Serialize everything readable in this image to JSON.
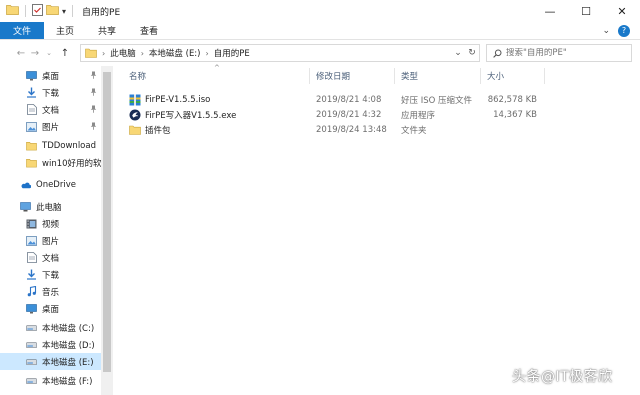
{
  "window": {
    "title": "自用的PE",
    "controls": {
      "minimize": "—",
      "maximize": "☐",
      "close": "✕"
    }
  },
  "ribbon": {
    "tabs": [
      "文件",
      "主页",
      "共享",
      "查看"
    ],
    "collapse_glyph": "⌄",
    "help_glyph": "?"
  },
  "address": {
    "crumbs": [
      "此电脑",
      "本地磁盘 (E:)",
      "自用的PE"
    ],
    "dropdown_glyph": "⌄",
    "refresh_glyph": "↻"
  },
  "search": {
    "placeholder": "搜索\"自用的PE\""
  },
  "nav_pane": {
    "items": [
      {
        "label": "桌面",
        "icon": "desktop-icon",
        "pinned": true
      },
      {
        "label": "下载",
        "icon": "download-icon",
        "pinned": true
      },
      {
        "label": "文档",
        "icon": "documents-icon",
        "pinned": true
      },
      {
        "label": "图片",
        "icon": "pictures-icon",
        "pinned": true
      },
      {
        "label": "TDDownload",
        "icon": "folder-icon",
        "pinned": false
      },
      {
        "label": "win10好用的软件",
        "icon": "folder-icon",
        "pinned": false
      },
      {
        "label": "OneDrive",
        "icon": "onedrive-icon",
        "pinned": false
      },
      {
        "label": "此电脑",
        "icon": "this-pc-icon",
        "pinned": false
      },
      {
        "label": "视频",
        "icon": "videos-icon",
        "pinned": false
      },
      {
        "label": "图片",
        "icon": "pictures-icon",
        "pinned": false
      },
      {
        "label": "文档",
        "icon": "documents-icon",
        "pinned": false
      },
      {
        "label": "下载",
        "icon": "download-icon",
        "pinned": false
      },
      {
        "label": "音乐",
        "icon": "music-icon",
        "pinned": false
      },
      {
        "label": "桌面",
        "icon": "desktop-icon",
        "pinned": false
      },
      {
        "label": "本地磁盘 (C:)",
        "icon": "drive-icon",
        "pinned": false
      },
      {
        "label": "本地磁盘 (D:)",
        "icon": "drive-icon",
        "pinned": false
      },
      {
        "label": "本地磁盘 (E:)",
        "icon": "drive-icon",
        "pinned": false,
        "selected": true
      },
      {
        "label": "本地磁盘 (F:)",
        "icon": "drive-icon",
        "pinned": false
      }
    ]
  },
  "file_list": {
    "columns": [
      "名称",
      "修改日期",
      "类型",
      "大小"
    ],
    "rows": [
      {
        "name": "FirPE-V1.5.5.iso",
        "date": "2019/8/21 4:08",
        "type": "好压 ISO 压缩文件",
        "size": "862,578 KB",
        "icon": "iso-archive-icon"
      },
      {
        "name": "FirPE写入器V1.5.5.exe",
        "date": "2019/8/21 4:32",
        "type": "应用程序",
        "size": "14,367 KB",
        "icon": "app-exe-icon"
      },
      {
        "name": "插件包",
        "date": "2019/8/24 13:48",
        "type": "文件夹",
        "size": "",
        "icon": "folder-icon"
      }
    ]
  },
  "watermark": "头条@IT极客欣",
  "colors": {
    "accent": "#1979ca",
    "selection": "#cce8ff",
    "folder": "#f8d775"
  }
}
